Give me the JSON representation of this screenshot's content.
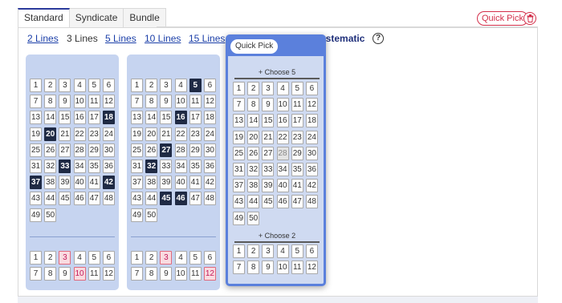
{
  "tabs": [
    {
      "label": "Standard",
      "active": true
    },
    {
      "label": "Syndicate",
      "active": false
    },
    {
      "label": "Bundle",
      "active": false
    }
  ],
  "quick_pick_label": "Quick Pick",
  "trash_icon": "trash-icon",
  "lines": [
    {
      "label": "2 Lines",
      "current": false
    },
    {
      "label": "3 Lines",
      "current": true
    },
    {
      "label": "5 Lines",
      "current": false
    },
    {
      "label": "10 Lines",
      "current": false
    },
    {
      "label": "15 Lines",
      "current": false
    },
    {
      "label": "Systematic",
      "current": false
    }
  ],
  "help_label": "?",
  "tickets": [
    {
      "main_numbers": [
        1,
        2,
        3,
        4,
        5,
        6,
        7,
        8,
        9,
        10,
        11,
        12,
        13,
        14,
        15,
        16,
        17,
        18,
        19,
        20,
        21,
        22,
        23,
        24,
        25,
        26,
        27,
        28,
        29,
        30,
        31,
        32,
        33,
        34,
        35,
        36,
        37,
        38,
        39,
        40,
        41,
        42,
        43,
        44,
        45,
        46,
        47,
        48,
        49,
        50
      ],
      "main_selected": [
        18,
        20,
        33,
        37,
        42
      ],
      "bonus_numbers": [
        1,
        2,
        3,
        4,
        5,
        6,
        7,
        8,
        9,
        10,
        11,
        12
      ],
      "bonus_selected": [
        3,
        10
      ]
    },
    {
      "main_numbers": [
        1,
        2,
        3,
        4,
        5,
        6,
        7,
        8,
        9,
        10,
        11,
        12,
        13,
        14,
        15,
        16,
        17,
        18,
        19,
        20,
        21,
        22,
        23,
        24,
        25,
        26,
        27,
        28,
        29,
        30,
        31,
        32,
        33,
        34,
        35,
        36,
        37,
        38,
        39,
        40,
        41,
        42,
        43,
        44,
        45,
        46,
        47,
        48,
        49,
        50
      ],
      "main_selected": [
        5,
        16,
        27,
        32,
        45,
        46
      ],
      "bonus_numbers": [
        1,
        2,
        3,
        4,
        5,
        6,
        7,
        8,
        9,
        10,
        11,
        12
      ],
      "bonus_selected": [
        3,
        12
      ]
    }
  ],
  "modal": {
    "quick_pick_label": "Quick Pick",
    "choose_main": "+ Choose 5",
    "choose_bonus": "+ Choose 2",
    "main_numbers": [
      1,
      2,
      3,
      4,
      5,
      6,
      7,
      8,
      9,
      10,
      11,
      12,
      13,
      14,
      15,
      16,
      17,
      18,
      19,
      20,
      21,
      22,
      23,
      24,
      25,
      26,
      27,
      28,
      29,
      30,
      31,
      32,
      33,
      34,
      35,
      36,
      37,
      38,
      39,
      40,
      41,
      42,
      43,
      44,
      45,
      46,
      47,
      48,
      49,
      50
    ],
    "main_hint": [
      28
    ],
    "bonus_numbers": [
      1,
      2,
      3,
      4,
      5,
      6,
      7,
      8,
      9,
      10,
      11,
      12
    ]
  },
  "colors": {
    "accent_blue": "#5b80dc",
    "selected_number": "#1f2a44",
    "bonus_selected": "#f9dbe0",
    "quick_pick_red": "#d32f4a"
  }
}
